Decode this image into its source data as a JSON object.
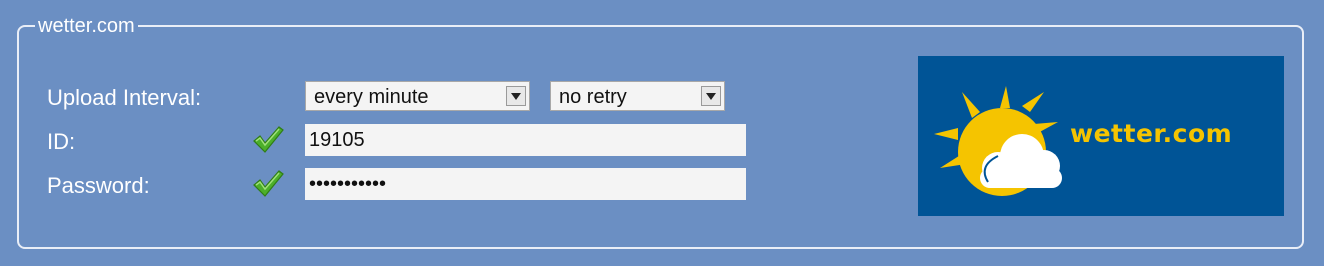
{
  "panel": {
    "legend": "wetter.com"
  },
  "form": {
    "upload_interval_label": "Upload Interval:",
    "interval_value": "every minute",
    "retry_value": "no retry",
    "id_label": "ID:",
    "id_value": "19105",
    "password_label": "Password:",
    "password_value": "•••••••••••"
  },
  "icons": {
    "id_status": "checkmark-icon",
    "password_status": "checkmark-icon",
    "dropdown": "chevron-down-icon",
    "logo_graphic": "sun-cloud-icon"
  },
  "logo": {
    "text": "wetter.com"
  },
  "colors": {
    "background": "#6b8fc3",
    "logo_background": "#005496",
    "logo_accent": "#f5c400",
    "check_green": "#4caf2a"
  }
}
